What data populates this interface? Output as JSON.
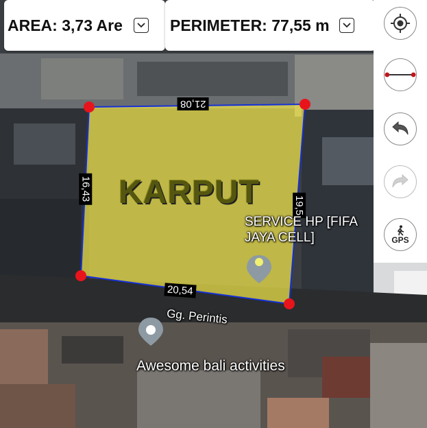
{
  "area": {
    "label": "AREA: 3,73 Are"
  },
  "perimeter": {
    "label": "PERIMETER: 77,55 m"
  },
  "toolbar": {
    "items": [
      {
        "name": "locate-icon"
      },
      {
        "name": "measure-line-icon"
      },
      {
        "name": "undo-icon"
      },
      {
        "name": "redo-icon"
      },
      {
        "name": "gps-icon",
        "label": "GPS"
      }
    ]
  },
  "polygon": {
    "fill": "#f2e64a",
    "edges": {
      "top": "21,08",
      "left": "16,43",
      "right": "19,5",
      "bottom": "20,54"
    }
  },
  "map": {
    "area_label": "KARPUT",
    "poi_service": "SERVICE HP [FIFA\nJAYA CELL]",
    "street": "Gg. Perintis",
    "poi_bali": "Awesome bali activities"
  },
  "colors": {
    "edge": "#1530d8",
    "vertex": "#e8141c",
    "pin": "#8d9aa3"
  }
}
